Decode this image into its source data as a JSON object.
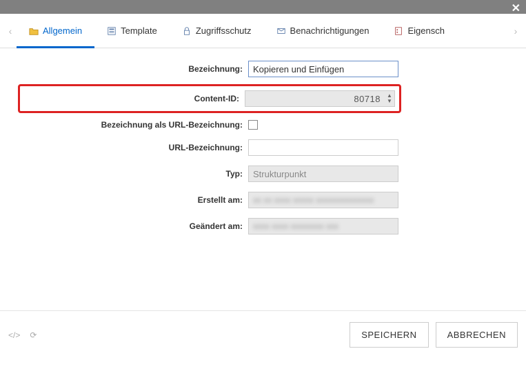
{
  "window": {
    "close_glyph": "✕"
  },
  "tabs": {
    "items": [
      {
        "label": "Allgemein"
      },
      {
        "label": "Template"
      },
      {
        "label": "Zugriffsschutz"
      },
      {
        "label": "Benachrichtigungen"
      },
      {
        "label": "Eigensch"
      }
    ],
    "arrow_left": "‹",
    "arrow_right": "›"
  },
  "form": {
    "bezeichnung": {
      "label": "Bezeichnung:",
      "value": "Kopieren und Einfügen"
    },
    "content_id": {
      "label": "Content-ID:",
      "value": "80718"
    },
    "url_flag": {
      "label": "Bezeichnung als URL-Bezeichnung:"
    },
    "url_bez": {
      "label": "URL-Bezeichnung:",
      "value": ""
    },
    "typ": {
      "label": "Typ:",
      "value": "Strukturpunkt"
    },
    "erstellt": {
      "label": "Erstellt am:",
      "value": "xx xx xxxx  xxxxx xxxxxxxxxxxxxx"
    },
    "geaendert": {
      "label": "Geändert am:",
      "value": "xxxx xxxx  xxxxxxxx xxx"
    }
  },
  "footer": {
    "save": "SPEICHERN",
    "cancel": "ABBRECHEN",
    "code_glyph": "</>",
    "reload_glyph": "⟳"
  }
}
